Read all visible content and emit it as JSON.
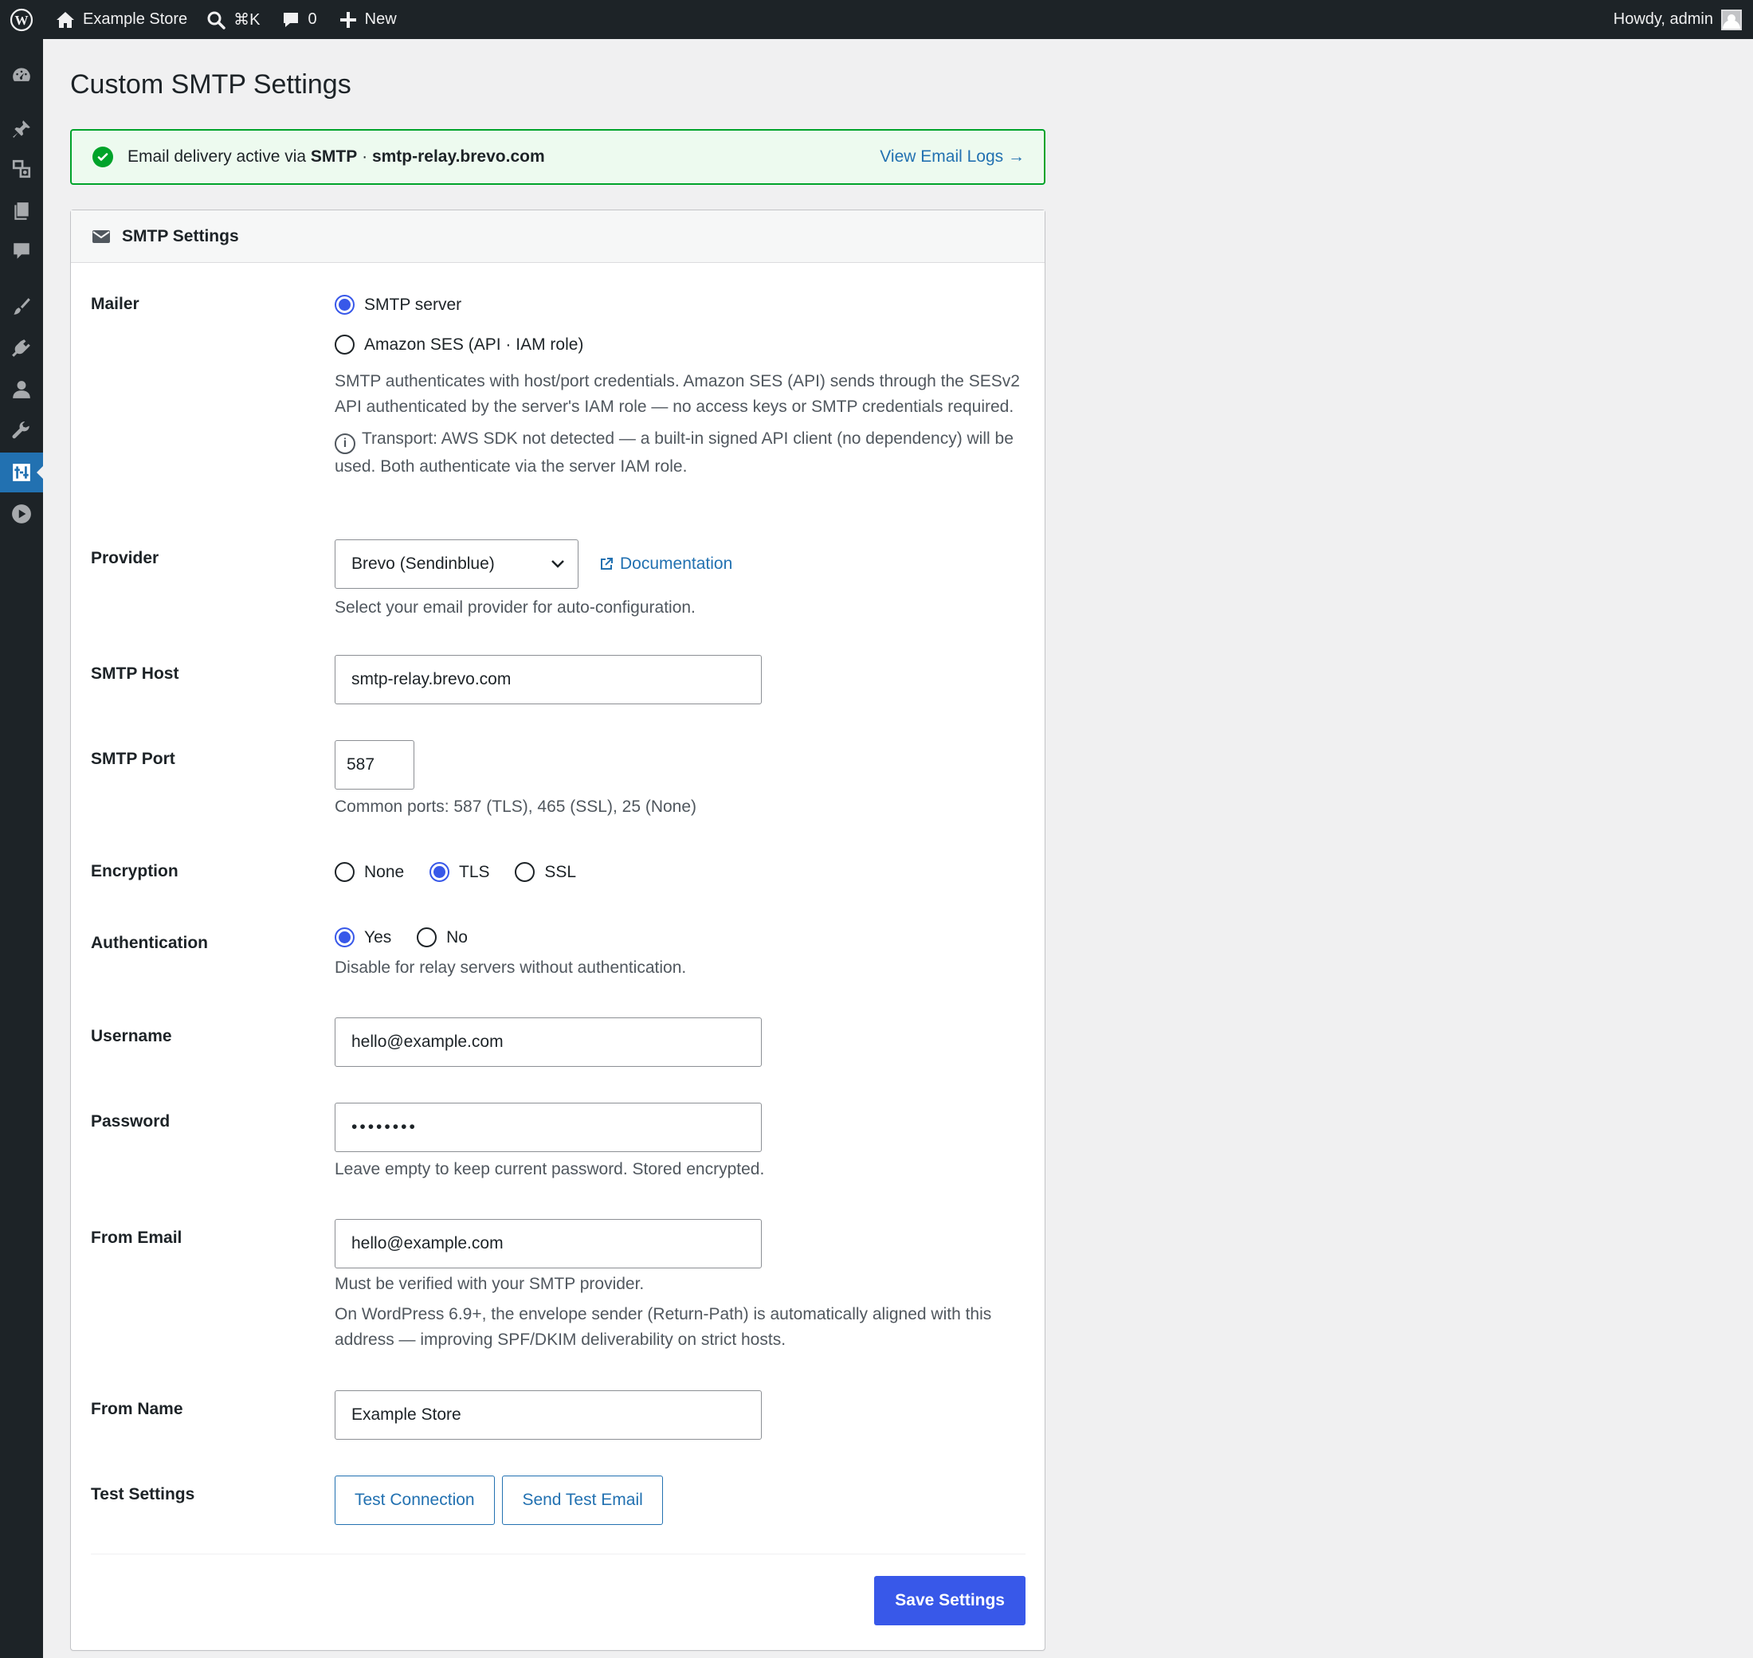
{
  "adminbar": {
    "site_name": "Example Store",
    "search_shortcut": "⌘K",
    "comments_count": "0",
    "new_label": "New",
    "howdy": "Howdy, admin"
  },
  "page": {
    "title": "Custom SMTP Settings"
  },
  "notice": {
    "prefix": "Email delivery active via ",
    "method": "SMTP",
    "separator": " · ",
    "host": "smtp-relay.brevo.com",
    "link_label": "View Email Logs →"
  },
  "card": {
    "title": "SMTP Settings"
  },
  "mailer": {
    "label": "Mailer",
    "options": [
      "SMTP server",
      "Amazon SES (API · IAM role)"
    ],
    "selected": "SMTP server",
    "description": "SMTP authenticates with host/port credentials. Amazon SES (API) sends through the SESv2 API authenticated by the server's IAM role — no access keys or SMTP credentials required.",
    "transport_note": "Transport: AWS SDK not detected — a built-in signed API client (no dependency) will be used. Both authenticate via the server IAM role."
  },
  "provider": {
    "label": "Provider",
    "selected": "Brevo (Sendinblue)",
    "doc_link": "Documentation",
    "description": "Select your email provider for auto-configuration."
  },
  "smtp_host": {
    "label": "SMTP Host",
    "value": "smtp-relay.brevo.com"
  },
  "smtp_port": {
    "label": "SMTP Port",
    "value": "587",
    "description": "Common ports: 587 (TLS), 465 (SSL), 25 (None)"
  },
  "encryption": {
    "label": "Encryption",
    "options": [
      "None",
      "TLS",
      "SSL"
    ],
    "selected": "TLS"
  },
  "authentication": {
    "label": "Authentication",
    "options": [
      "Yes",
      "No"
    ],
    "selected": "Yes",
    "description": "Disable for relay servers without authentication."
  },
  "username": {
    "label": "Username",
    "value": "hello@example.com"
  },
  "password": {
    "label": "Password",
    "value": "••••••••",
    "description": "Leave empty to keep current password. Stored encrypted."
  },
  "from_email": {
    "label": "From Email",
    "value": "hello@example.com",
    "description": "Must be verified with your SMTP provider.",
    "note": "On WordPress 6.9+, the envelope sender (Return-Path) is automatically aligned with this address — improving SPF/DKIM deliverability on strict hosts."
  },
  "from_name": {
    "label": "From Name",
    "value": "Example Store"
  },
  "test_settings": {
    "label": "Test Settings",
    "test_connection": "Test Connection",
    "send_test_email": "Send Test Email"
  },
  "save_label": "Save Settings",
  "colors": {
    "accent": "#3858e9",
    "link": "#2271b1",
    "success": "#00a32a",
    "adminbar": "#1d2327"
  }
}
